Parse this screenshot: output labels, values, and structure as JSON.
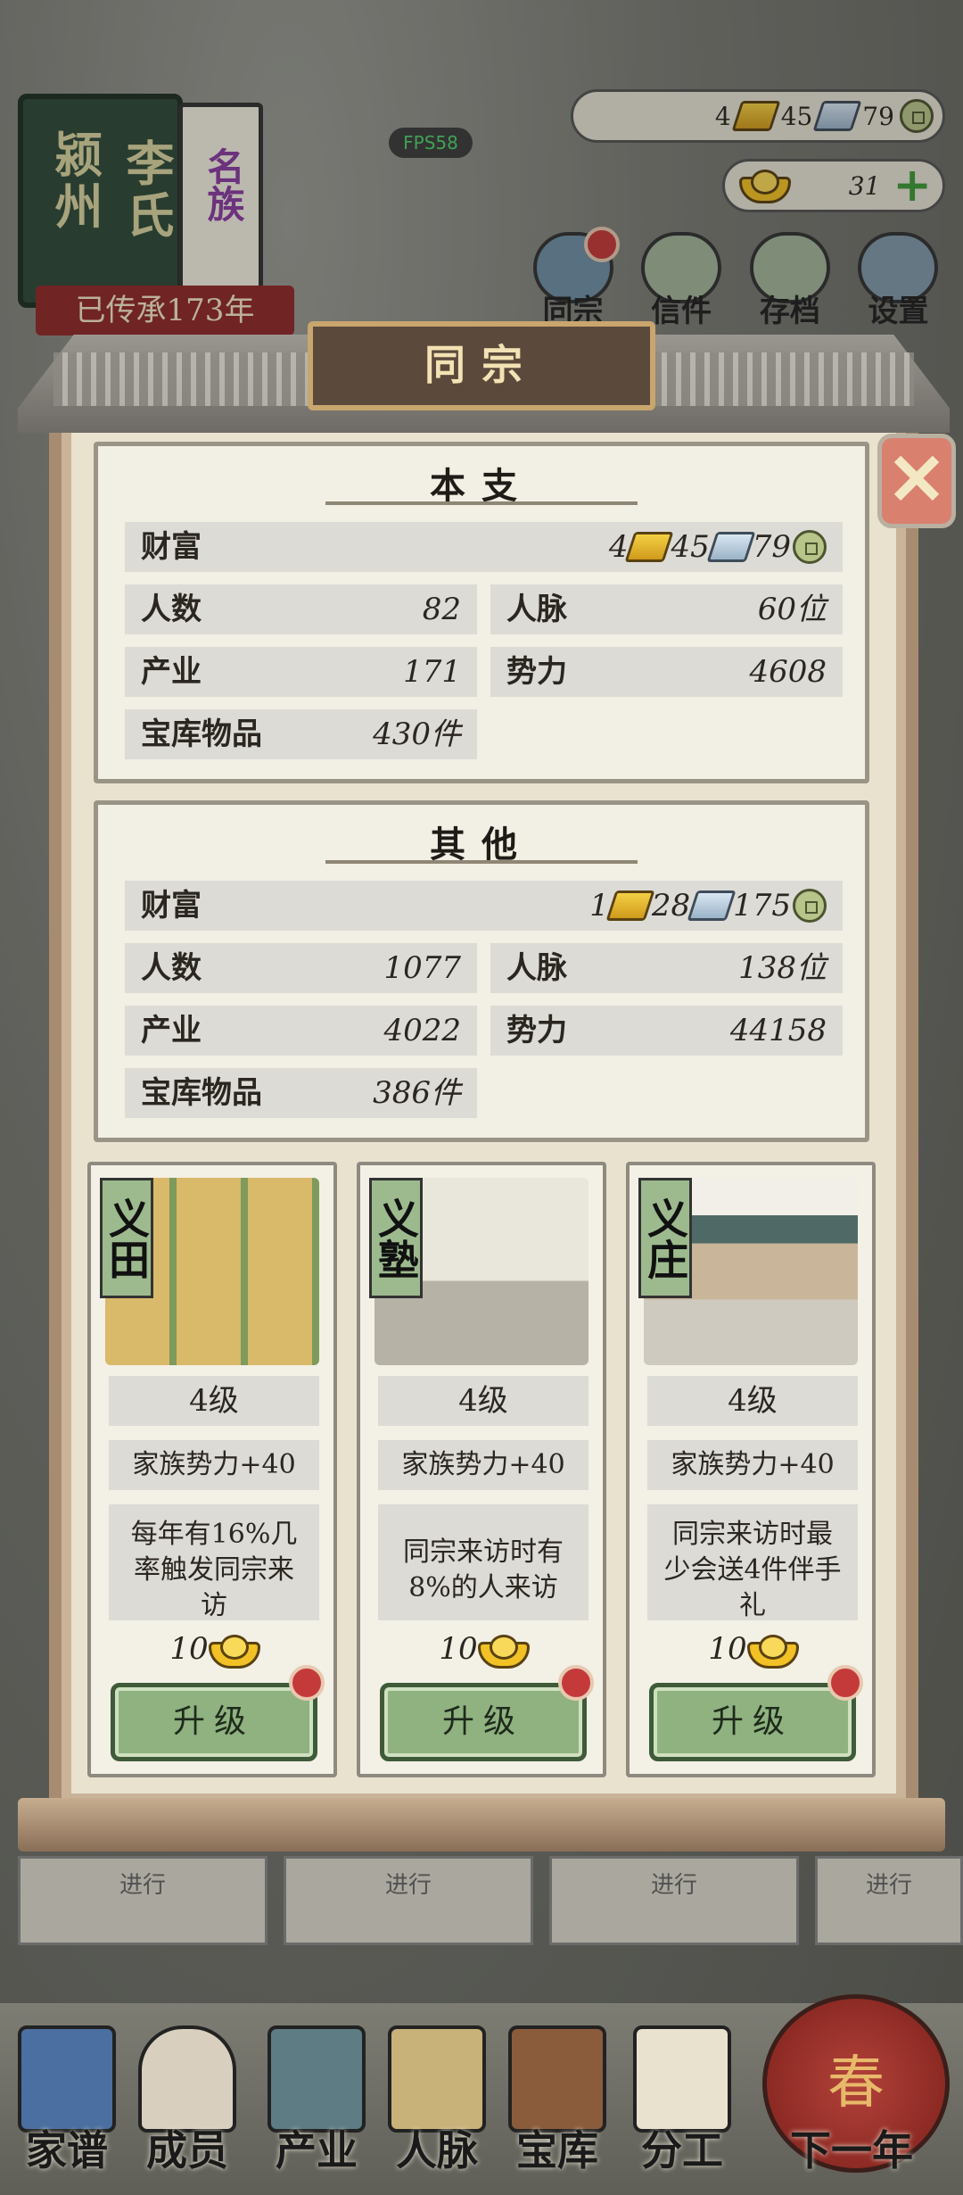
{
  "hud": {
    "book": {
      "line1": "颍州",
      "line2": "李氏",
      "clan_mark": "名族"
    },
    "inherit_text": "已传承173年",
    "fps": "FPS58",
    "resources": {
      "gold": "4",
      "silver": "45",
      "copper": "79"
    },
    "yuanbao": "31"
  },
  "top_menu": [
    {
      "label": "同宗"
    },
    {
      "label": "信件"
    },
    {
      "label": "存档"
    },
    {
      "label": "设置"
    }
  ],
  "modal": {
    "title": "同宗",
    "close_icon": "close-icon",
    "own_branch": {
      "title": "本支",
      "wealth_label": "财富",
      "wealth": {
        "gold": "4",
        "silver": "45",
        "copper": "79"
      },
      "rows": [
        {
          "label": "人数",
          "value": "82"
        },
        {
          "label": "人脉",
          "value": "60位"
        },
        {
          "label": "产业",
          "value": "171"
        },
        {
          "label": "势力",
          "value": "4608"
        },
        {
          "label": "宝库物品",
          "value": "430件"
        }
      ]
    },
    "other_branch": {
      "title": "其他",
      "wealth_label": "财富",
      "wealth": {
        "gold": "1",
        "silver": "28",
        "copper": "175"
      },
      "rows": [
        {
          "label": "人数",
          "value": "1077"
        },
        {
          "label": "人脉",
          "value": "138位"
        },
        {
          "label": "产业",
          "value": "4022"
        },
        {
          "label": "势力",
          "value": "44158"
        },
        {
          "label": "宝库物品",
          "value": "386件"
        }
      ]
    },
    "buildings": [
      {
        "tag": "义田",
        "level": "4级",
        "bonus": "家族势力+40",
        "desc": "每年有16%几率触发同宗来访",
        "cost": "10",
        "button": "升级"
      },
      {
        "tag": "义塾",
        "level": "4级",
        "bonus": "家族势力+40",
        "desc": "同宗来访时有8%的人来访",
        "cost": "10",
        "button": "升级"
      },
      {
        "tag": "义庄",
        "level": "4级",
        "bonus": "家族势力+40",
        "desc": "同宗来访时最少会送4件伴手礼",
        "cost": "10",
        "button": "升级"
      }
    ]
  },
  "under_tabs": [
    "进行",
    "进行",
    "进行",
    "进行"
  ],
  "bottom_nav": [
    {
      "label": "家谱"
    },
    {
      "label": "成员"
    },
    {
      "label": "产业"
    },
    {
      "label": "人脉"
    },
    {
      "label": "宝库"
    },
    {
      "label": "分工"
    },
    {
      "label": "下一年"
    }
  ],
  "lantern_text": "春",
  "colors": {
    "accent_green": "#8fb280",
    "red_dot": "#c43a3a",
    "plaque": "#5b4a3c"
  }
}
